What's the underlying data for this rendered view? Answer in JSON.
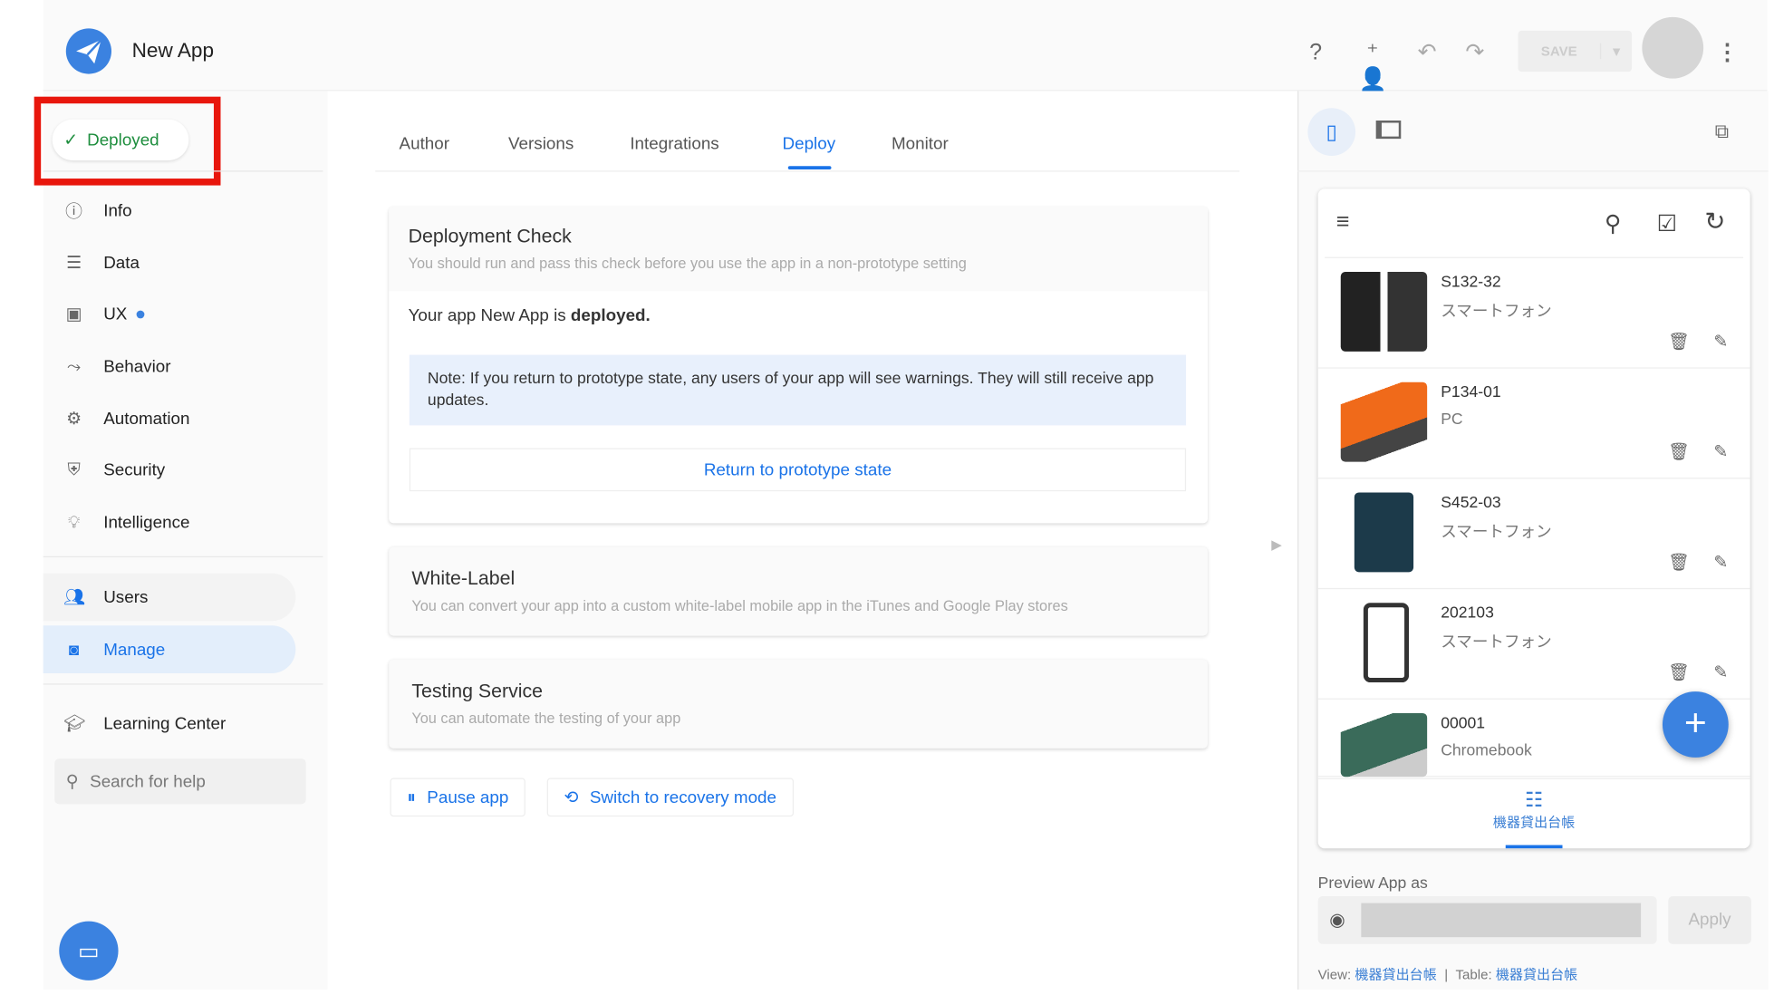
{
  "app": {
    "title": "New App"
  },
  "topbar": {
    "save_label": "SAVE",
    "icons": [
      "help-icon",
      "add-user-icon",
      "undo-icon",
      "redo-icon",
      "more-vert-icon"
    ]
  },
  "sidebar": {
    "status": "Deployed",
    "items": [
      {
        "label": "Info"
      },
      {
        "label": "Data"
      },
      {
        "label": "UX"
      },
      {
        "label": "Behavior"
      },
      {
        "label": "Automation"
      },
      {
        "label": "Security"
      },
      {
        "label": "Intelligence"
      },
      {
        "label": "Users"
      },
      {
        "label": "Manage"
      },
      {
        "label": "Learning Center"
      }
    ],
    "search_placeholder": "Search for help"
  },
  "tabs": [
    {
      "label": "Author"
    },
    {
      "label": "Versions"
    },
    {
      "label": "Integrations"
    },
    {
      "label": "Deploy"
    },
    {
      "label": "Monitor"
    }
  ],
  "deployment_check": {
    "title": "Deployment Check",
    "subtitle": "You should run and pass this check before you use the app in a non-prototype setting",
    "status_prefix": "Your app New App is ",
    "status_value": "deployed.",
    "note": "Note: If you return to prototype state, any users of your app will see warnings. They will still receive app updates.",
    "return_button": "Return to prototype state"
  },
  "white_label": {
    "title": "White-Label",
    "subtitle": "You can convert your app into a custom white-label mobile app in the iTunes and Google Play stores"
  },
  "testing": {
    "title": "Testing Service",
    "subtitle": "You can automate the testing of your app"
  },
  "actions": {
    "pause": "Pause app",
    "recovery": "Switch to recovery mode"
  },
  "preview": {
    "rows": [
      {
        "id": "S132-32",
        "type": "スマートフォン"
      },
      {
        "id": "P134-01",
        "type": "PC"
      },
      {
        "id": "S452-03",
        "type": "スマートフォン"
      },
      {
        "id": "202103",
        "type": "スマートフォン"
      },
      {
        "id": "00001",
        "type": "Chromebook"
      }
    ],
    "nav_label": "機器貸出台帳",
    "preview_as_label": "Preview App as",
    "apply": "Apply",
    "view_label": "View:",
    "view_value": "機器貸出台帳",
    "table_label": "Table:",
    "table_value": "機器貸出台帳"
  },
  "colors": {
    "accent": "#1a73e8",
    "deployed": "#1e8e3e",
    "highlight": "#e8160c"
  }
}
